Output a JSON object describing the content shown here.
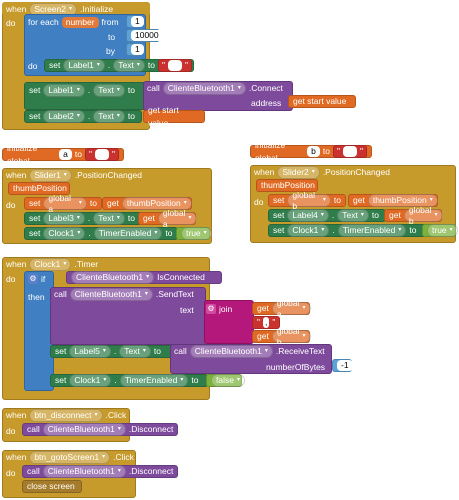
{
  "screen_init": {
    "when": "when",
    "component": "Screen2",
    "event": ".Initialize",
    "do": "do",
    "for_each": "for each",
    "var": "number",
    "from": "from",
    "from_val": "1",
    "to": "to",
    "to_val": "10000",
    "by": "by",
    "by_val": "1",
    "do2": "do",
    "set": "set",
    "label1": "Label1",
    "prop_text": "Text",
    "to_kw": "to",
    "empty_str": "",
    "call": "call",
    "bt": "ClienteBluetooth1",
    "connect": ".Connect",
    "address": "address",
    "get_start": "get start value",
    "label2": "Label2"
  },
  "globals": {
    "init": "initialize global",
    "a": "a",
    "b": "b",
    "to": "to",
    "empty": ""
  },
  "slider1": {
    "when": "when",
    "component": "Slider1",
    "event": ".PositionChanged",
    "param": "thumbPosition",
    "do": "do",
    "set": "set",
    "global_a": "global a",
    "to": "to",
    "get": "get",
    "get_thumb": "thumbPosition",
    "label3": "Label3",
    "text": "Text",
    "get_global_a": "global a",
    "clock1": "Clock1",
    "timer_enabled": "TimerEnabled",
    "true": "true"
  },
  "slider2": {
    "when": "when",
    "component": "Slider2",
    "event": ".PositionChanged",
    "param": "thumbPosition",
    "do": "do",
    "set": "set",
    "global_b": "global b",
    "to": "to",
    "get": "get",
    "get_thumb": "thumbPosition",
    "label4": "Label4",
    "text": "Text",
    "get_global_b": "global b",
    "clock1": "Clock1",
    "timer_enabled": "TimerEnabled",
    "true": "true"
  },
  "clock": {
    "when": "when",
    "component": "Clock1",
    "event": ".Timer",
    "do": "do",
    "if": "if",
    "then": "then",
    "bt": "ClienteBluetooth1",
    "is_connected": "IsConnected",
    "call": "call",
    "send_text": ".SendText",
    "text": "text",
    "join": "join",
    "get": "get",
    "global_a": "global a",
    "comma": ",",
    "global_b": "global b",
    "set": "set",
    "label5": "Label5",
    "prop_text": "Text",
    "to": "to",
    "receive_text": ".ReceiveText",
    "number_of_bytes": "numberOfBytes",
    "neg1": "-1",
    "clock1": "Clock1",
    "timer_enabled": "TimerEnabled",
    "false": "false"
  },
  "btn_disconnect": {
    "when": "when",
    "component": "btn_disconnect",
    "event": ".Click",
    "do": "do",
    "call": "call",
    "bt": "ClienteBluetooth1",
    "disconnect": ".Disconnect"
  },
  "btn_goto": {
    "when": "when",
    "component": "btn_gotoScreen1",
    "event": ".Click",
    "do": "do",
    "call": "call",
    "bt": "ClienteBluetooth1",
    "disconnect": ".Disconnect",
    "close": "close screen"
  }
}
